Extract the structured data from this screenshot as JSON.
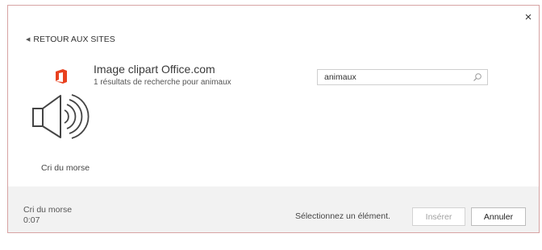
{
  "dialog": {
    "close_label": "×",
    "back_label": "RETOUR AUX SITES",
    "provider": {
      "title": "Image clipart Office.com",
      "results": "1 résultats de recherche pour animaux",
      "logo_icon": "office-logo-icon",
      "brand_color": "#e8411f"
    },
    "search": {
      "value": "animaux",
      "icon": "search-icon"
    },
    "results": [
      {
        "label": "Cri du morse",
        "icon": "speaker-sound-icon"
      }
    ]
  },
  "footer": {
    "selected_title": "Cri du morse",
    "selected_duration": "0:07",
    "hint": "Sélectionnez un élément.",
    "insert_label": "Insérer",
    "cancel_label": "Annuler"
  }
}
